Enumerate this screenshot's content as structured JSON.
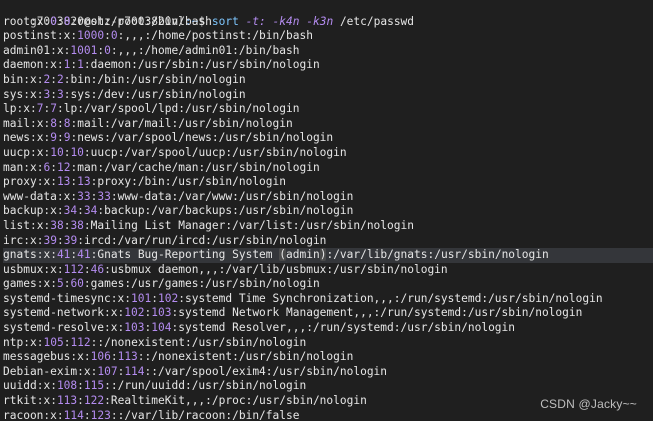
{
  "prompt": {
    "user_host": "g7003820@shz-p7003820vl",
    "path": ":~",
    "symbol": "$",
    "command": "sort",
    "args": [
      "-t:",
      "-k4n",
      "-k3n"
    ],
    "target": "/etc/passwd"
  },
  "rows": [
    {
      "name": "root",
      "x": "x",
      "uid": "0",
      "gid": "0",
      "rest": "root:/root:/bin/bash"
    },
    {
      "name": "postinst",
      "x": "x",
      "uid": "1000",
      "gid": "0",
      "rest": ",,,:/home/postinst:/bin/bash"
    },
    {
      "name": "admin01",
      "x": "x",
      "uid": "1001",
      "gid": "0",
      "rest": ",,,:/home/admin01:/bin/bash"
    },
    {
      "name": "daemon",
      "x": "x",
      "uid": "1",
      "gid": "1",
      "rest": "daemon:/usr/sbin:/usr/sbin/nologin"
    },
    {
      "name": "bin",
      "x": "x",
      "uid": "2",
      "gid": "2",
      "rest": "bin:/bin:/usr/sbin/nologin"
    },
    {
      "name": "sys",
      "x": "x",
      "uid": "3",
      "gid": "3",
      "rest": "sys:/dev:/usr/sbin/nologin"
    },
    {
      "name": "lp",
      "x": "x",
      "uid": "7",
      "gid": "7",
      "rest": "lp:/var/spool/lpd:/usr/sbin/nologin"
    },
    {
      "name": "mail",
      "x": "x",
      "uid": "8",
      "gid": "8",
      "rest": "mail:/var/mail:/usr/sbin/nologin"
    },
    {
      "name": "news",
      "x": "x",
      "uid": "9",
      "gid": "9",
      "rest": "news:/var/spool/news:/usr/sbin/nologin"
    },
    {
      "name": "uucp",
      "x": "x",
      "uid": "10",
      "gid": "10",
      "rest": "uucp:/var/spool/uucp:/usr/sbin/nologin"
    },
    {
      "name": "man",
      "x": "x",
      "uid": "6",
      "gid": "12",
      "rest": "man:/var/cache/man:/usr/sbin/nologin"
    },
    {
      "name": "proxy",
      "x": "x",
      "uid": "13",
      "gid": "13",
      "rest": "proxy:/bin:/usr/sbin/nologin"
    },
    {
      "name": "www-data",
      "x": "x",
      "uid": "33",
      "gid": "33",
      "rest": "www-data:/var/www:/usr/sbin/nologin"
    },
    {
      "name": "backup",
      "x": "x",
      "uid": "34",
      "gid": "34",
      "rest": "backup:/var/backups:/usr/sbin/nologin"
    },
    {
      "name": "list",
      "x": "x",
      "uid": "38",
      "gid": "38",
      "rest": "Mailing List Manager:/var/list:/usr/sbin/nologin"
    },
    {
      "name": "irc",
      "x": "x",
      "uid": "39",
      "gid": "39",
      "rest": "ircd:/var/run/ircd:/usr/sbin/nologin"
    },
    {
      "name": "gnats",
      "x": "x",
      "uid": "41",
      "gid": "41",
      "rest_pre": "Gnats Bug-Reporting System ",
      "rest_paren": "admin",
      "rest_post": ":/var/lib/gnats:/usr/sbin/nologin",
      "highlight": true
    },
    {
      "name": "usbmux",
      "x": "x",
      "uid": "112",
      "gid": "46",
      "rest": "usbmux daemon,,,:/var/lib/usbmux:/usr/sbin/nologin"
    },
    {
      "name": "games",
      "x": "x",
      "uid": "5",
      "gid": "60",
      "rest": "games:/usr/games:/usr/sbin/nologin"
    },
    {
      "name": "systemd-timesync",
      "x": "x",
      "uid": "101",
      "gid": "102",
      "rest": "systemd Time Synchronization,,,:/run/systemd:/usr/sbin/nologin"
    },
    {
      "name": "systemd-network",
      "x": "x",
      "uid": "102",
      "gid": "103",
      "rest": "systemd Network Management,,,:/run/systemd:/usr/sbin/nologin"
    },
    {
      "name": "systemd-resolve",
      "x": "x",
      "uid": "103",
      "gid": "104",
      "rest": "systemd Resolver,,,:/run/systemd:/usr/sbin/nologin"
    },
    {
      "name": "ntp",
      "x": "x",
      "uid": "105",
      "gid": "112",
      "rest": ":/nonexistent:/usr/sbin/nologin"
    },
    {
      "name": "messagebus",
      "x": "x",
      "uid": "106",
      "gid": "113",
      "rest": ":/nonexistent:/usr/sbin/nologin"
    },
    {
      "name": "Debian-exim",
      "x": "x",
      "uid": "107",
      "gid": "114",
      "rest": ":/var/spool/exim4:/usr/sbin/nologin"
    },
    {
      "name": "uuidd",
      "x": "x",
      "uid": "108",
      "gid": "115",
      "rest": ":/run/uuidd:/usr/sbin/nologin"
    },
    {
      "name": "rtkit",
      "x": "x",
      "uid": "113",
      "gid": "122",
      "rest": "RealtimeKit,,,:/proc:/usr/sbin/nologin"
    },
    {
      "name": "racoon",
      "x": "x",
      "uid": "114",
      "gid": "123",
      "rest": ":/var/lib/racoon:/bin/false"
    }
  ],
  "watermark": "CSDN @Jacky~~",
  "colors": {
    "background": "#1f1f1f",
    "text": "#e6e6e6",
    "number": "#b48cf0",
    "command": "#7ec7ff",
    "highlight_row": "#34363a"
  }
}
